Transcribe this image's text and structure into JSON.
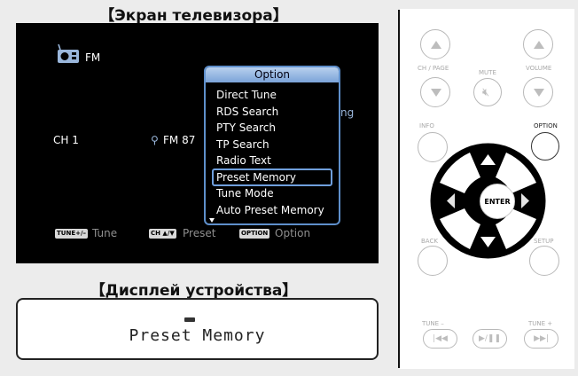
{
  "tv_section": {
    "heading": "【Экран телевизора】",
    "band": "FM",
    "channel": "CH 1",
    "frequency": "FM 87",
    "hidden_tail": "ng",
    "bottom_bar": [
      {
        "key": "TUNE+/–",
        "label": "Tune"
      },
      {
        "key": "CH ▲/▼",
        "label": "Preset"
      },
      {
        "key": "OPTION",
        "label": "Option"
      }
    ],
    "option_menu": {
      "title": "Option",
      "selected": "Preset Memory",
      "items": [
        "Direct Tune",
        "RDS Search",
        "PTY Search",
        "TP Search",
        "Radio Text",
        "Preset Memory",
        "Tune Mode",
        "Auto Preset Memory"
      ]
    }
  },
  "device_section": {
    "heading": "【Дисплей устройства】",
    "text": "Preset Memory"
  },
  "remote": {
    "ch_page": "CH / PAGE",
    "mute": "MUTE",
    "volume": "VOLUME",
    "info": "INFO",
    "option": "OPTION",
    "enter": "ENTER",
    "back": "BACK",
    "setup": "SETUP",
    "tune_minus": "TUNE –",
    "tune_plus": "TUNE +"
  }
}
